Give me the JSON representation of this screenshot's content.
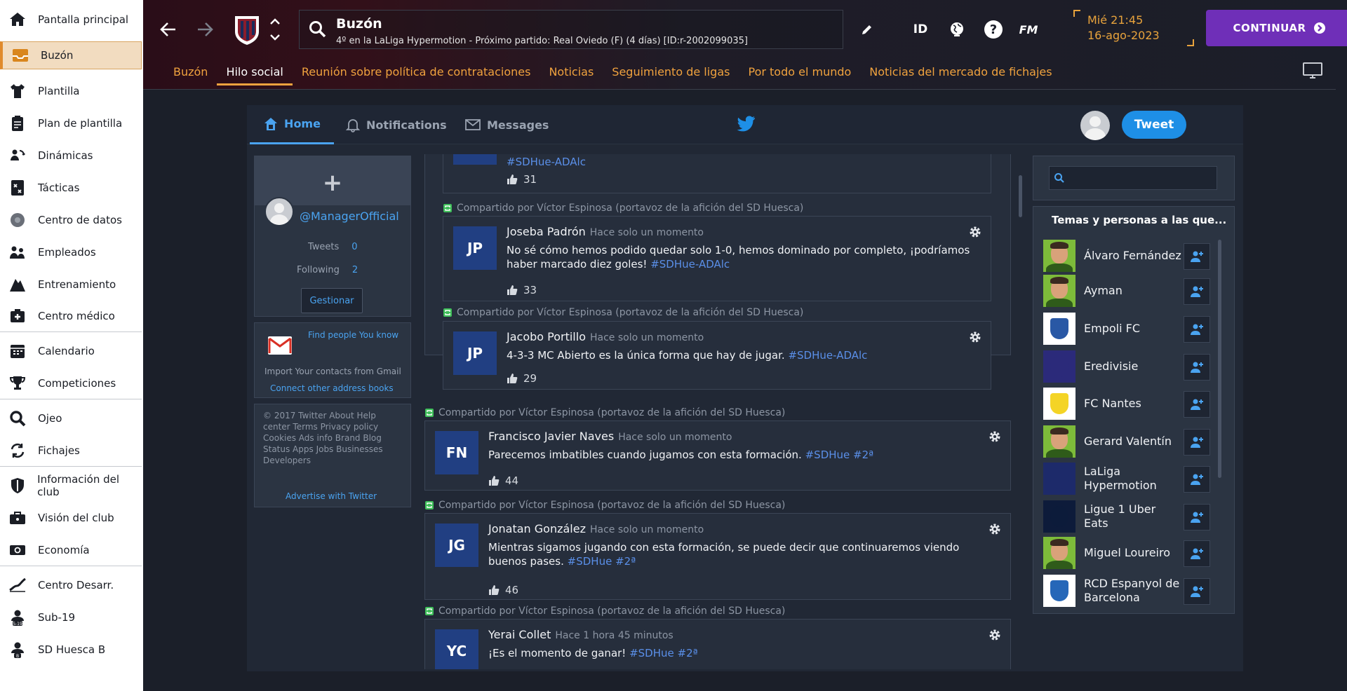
{
  "sidebar": {
    "items": [
      {
        "label": "Pantalla principal",
        "icon": "home-icon"
      },
      {
        "label": "Buzón",
        "icon": "inbox-icon"
      },
      {
        "label": "Plantilla",
        "icon": "shirt-icon"
      },
      {
        "label": "Plan de plantilla",
        "icon": "clipboard-icon"
      },
      {
        "label": "Dinámicas",
        "icon": "dynamics-icon"
      },
      {
        "label": "Tácticas",
        "icon": "tactics-icon"
      },
      {
        "label": "Centro de datos",
        "icon": "data-icon"
      },
      {
        "label": "Empleados",
        "icon": "staff-icon"
      },
      {
        "label": "Entrenamiento",
        "icon": "training-icon"
      },
      {
        "label": "Centro médico",
        "icon": "medical-icon"
      },
      {
        "label": "Calendario",
        "icon": "calendar-icon"
      },
      {
        "label": "Competiciones",
        "icon": "trophy-icon"
      },
      {
        "label": "Ojeo",
        "icon": "scouting-icon"
      },
      {
        "label": "Fichajes",
        "icon": "transfers-icon"
      },
      {
        "label": "Información del club",
        "icon": "shield-icon"
      },
      {
        "label": "Visión del club",
        "icon": "briefcase-icon"
      },
      {
        "label": "Economía",
        "icon": "money-icon"
      },
      {
        "label": "Centro Desarr.",
        "icon": "development-icon"
      },
      {
        "label": "Sub-19",
        "icon": "u19-icon"
      },
      {
        "label": "SD Huesca B",
        "icon": "reserve-icon"
      }
    ]
  },
  "header": {
    "title": "Buzón",
    "subtitle": "4º en la LaLiga Hypermotion - Próximo partido: Real Oviedo (F) (4 días) [ID:r-2002099035]",
    "id_label": "ID",
    "fm_label": "FM",
    "date_line1": "Mié 21:45",
    "date_line2": "16-ago-2023",
    "continue_label": "CONTINUAR"
  },
  "tabs": [
    "Buzón",
    "Hilo social",
    "Reunión sobre política de contrataciones",
    "Noticias",
    "Seguimiento de ligas",
    "Por todo el mundo",
    "Noticias del mercado de fichajes"
  ],
  "twitter": {
    "nav": {
      "home": "Home",
      "notifications": "Notifications",
      "messages": "Messages",
      "tweet": "Tweet"
    },
    "profile": {
      "handle": "@ManagerOfficial",
      "tweets_label": "Tweets",
      "tweets": "0",
      "following_label": "Following",
      "following": "2",
      "manage": "Gestionar"
    },
    "contacts": {
      "find": "Find people You know",
      "import": "Import Your contacts from Gmail",
      "connect": "Connect other address books"
    },
    "footer": {
      "line1": "© 2017 Twitter  About  Help",
      "line2": "center  Terms  Privacy policy",
      "line3": "Cookies  Ads info  Brand  Blog",
      "line4": "Status  Apps  Jobs  Businesses",
      "line5": "Developers",
      "advertise": "Advertise with Twitter"
    },
    "shared_by": "Compartido por Víctor Espinosa (portavoz de la afición del SD Huesca)",
    "partial_tweet": {
      "hashtag": "#SDHue-ADAlc",
      "likes": "31"
    },
    "quoted": [
      {
        "initials": "JP",
        "name": "Joseba Padrón",
        "time": "Hace solo un momento",
        "text": "No sé cómo hemos podido quedar solo 1-0, hemos dominado por completo, ¡podríamos haber marcado diez goles!",
        "hashtag": "#SDHue-ADAlc",
        "likes": "33"
      },
      {
        "initials": "JP",
        "name": "Jacobo Portillo",
        "time": "Hace solo un momento",
        "text": "4-3-3 MC Abierto es la única forma que hay de jugar.",
        "hashtag": "#SDHue-ADAlc",
        "likes": "29"
      }
    ],
    "tweets": [
      {
        "initials": "FN",
        "name": "Francisco Javier Naves",
        "time": "Hace solo un momento",
        "text": "Parecemos imbatibles cuando jugamos con esta formación.",
        "hashtag": "#SDHue #2ª",
        "likes": "44"
      },
      {
        "initials": "JG",
        "name": "Jonatan González",
        "time": "Hace solo un momento",
        "text": "Mientras sigamos jugando con esta formación, se puede decir que continuaremos viendo buenos pases.",
        "hashtag": "#SDHue #2ª",
        "likes": "46"
      },
      {
        "initials": "YC",
        "name": "Yerai Collet",
        "time": "Hace 1 hora 45 minutos",
        "text": "¡Es el momento de ganar!",
        "hashtag": "#SDHue #2ª",
        "likes": ""
      }
    ],
    "follow": {
      "title": "Temas y personas a las que...",
      "items": [
        {
          "name": "Álvaro Fernández",
          "kind": "person"
        },
        {
          "name": "Ayman",
          "kind": "person"
        },
        {
          "name": "Empoli FC",
          "kind": "club",
          "color": "#1d4fa0"
        },
        {
          "name": "Eredivisie",
          "kind": "league",
          "color": "#2b2a7a"
        },
        {
          "name": "FC Nantes",
          "kind": "club",
          "color": "#f3d21a"
        },
        {
          "name": "Gerard Valentín",
          "kind": "person"
        },
        {
          "name": "LaLiga Hypermotion",
          "kind": "league",
          "color": "#1d2a6a"
        },
        {
          "name": "Ligue 1 Uber Eats",
          "kind": "league",
          "color": "#0d1b3a"
        },
        {
          "name": "Miguel Loureiro",
          "kind": "person"
        },
        {
          "name": "RCD Espanyol de Barcelona",
          "kind": "club",
          "color": "#1a5fb4"
        }
      ]
    }
  },
  "colors": {
    "accent": "#f0a23e",
    "continue": "#6f2fb8",
    "twitter_blue": "#1e8fe6",
    "link": "#4aa3f0"
  }
}
